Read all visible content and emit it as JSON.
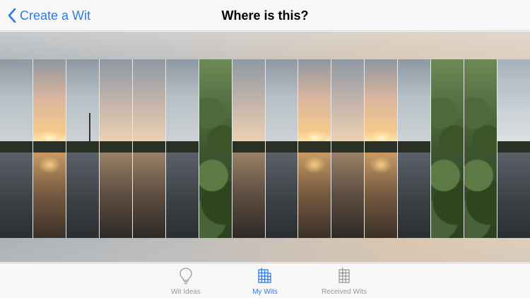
{
  "nav": {
    "back_label": "Create a Wit",
    "title": "Where is this?"
  },
  "tabs": [
    {
      "label": "Wit Ideas",
      "icon": "lightbulb-icon",
      "active": false
    },
    {
      "label": "My Wits",
      "icon": "grid-icon",
      "active": true
    },
    {
      "label": "Received Wits",
      "icon": "received-grid-icon",
      "active": false
    }
  ],
  "colors": {
    "accent": "#2f7ae5",
    "inactive_tab": "#9a9a9a",
    "bar_background": "#f7f7f7"
  },
  "strips": [
    {
      "scene": "cloudy-lake"
    },
    {
      "scene": "sunset-lake"
    },
    {
      "scene": "pylon-lake"
    },
    {
      "scene": "dusk-lake"
    },
    {
      "scene": "dusk-lake"
    },
    {
      "scene": "cloudy-lake"
    },
    {
      "scene": "bushes"
    },
    {
      "scene": "dusk-lake"
    },
    {
      "scene": "cloudy-lake"
    },
    {
      "scene": "sunset-lake"
    },
    {
      "scene": "dusk-lake"
    },
    {
      "scene": "sunset-lake"
    },
    {
      "scene": "cloudy-lake"
    },
    {
      "scene": "wires-bushes"
    },
    {
      "scene": "trees-shore"
    },
    {
      "scene": "pale-shore"
    }
  ]
}
